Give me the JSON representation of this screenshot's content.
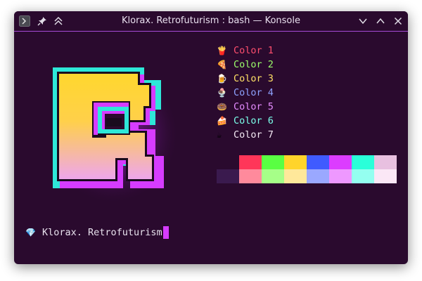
{
  "window": {
    "title": "Klorax. Retrofuturism : bash — Konsole",
    "icons": {
      "app": "terminal-icon",
      "pin": "pin-icon",
      "keep_above": "double-chevron-up-icon",
      "minimize": "chevron-down-icon",
      "maximize": "chevron-up-icon",
      "close": "close-icon"
    }
  },
  "palette": [
    {
      "emoji": "🍟",
      "label": "Color 1",
      "color": "#ff4f6e"
    },
    {
      "emoji": "🍕",
      "label": "Color 2",
      "color": "#9cff6b"
    },
    {
      "emoji": "🍺",
      "label": "Color 3",
      "color": "#ffe066"
    },
    {
      "emoji": "🍨",
      "label": "Color 4",
      "color": "#8fa3ff"
    },
    {
      "emoji": "🍩",
      "label": "Color 5",
      "color": "#e58cff"
    },
    {
      "emoji": "🍰",
      "label": "Color 6",
      "color": "#7affea"
    },
    {
      "emoji": "☕",
      "label": "Color 7",
      "color": "#f4e9f4"
    }
  ],
  "swatches": {
    "top": [
      "#2a0a2e",
      "#ff3659",
      "#59ff42",
      "#ffd42a",
      "#3f5bff",
      "#dc3cff",
      "#2affd9",
      "#e8c0e0"
    ],
    "bottom": [
      "#3a1a4e",
      "#ff8a9c",
      "#a6ff88",
      "#ffe89a",
      "#9aa8ff",
      "#ee98ff",
      "#94fff0",
      "#fbe7f6"
    ]
  },
  "prompt": {
    "emoji": "💎",
    "text": "Klorax. Retrofuturism"
  },
  "colors": {
    "background": "#2a0a2e",
    "accent": "#a64ad6",
    "cursor": "#d63cff",
    "logo_outline": "#2ee8d8",
    "logo_shadow": "#d63cff",
    "logo_top": "#ffd72e",
    "logo_bottom": "#f0a6e8"
  }
}
